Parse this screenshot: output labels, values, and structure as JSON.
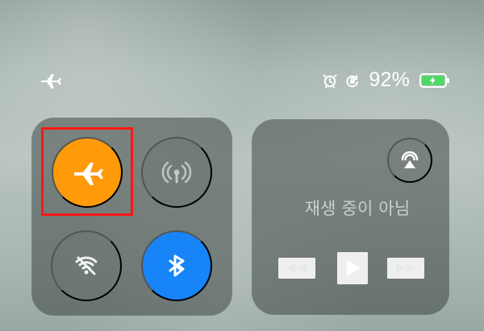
{
  "status_bar": {
    "battery_percent": "92%",
    "left_icon": "airplane-icon",
    "right_icons": [
      "alarm-icon",
      "rotation-lock-icon",
      "battery-icon"
    ]
  },
  "connectivity": {
    "airplane_icon": "airplane-icon",
    "cellular_icon": "cellular-data-icon",
    "wifi_icon": "wifi-off-icon",
    "bluetooth_icon": "bluetooth-icon",
    "airplane_color": "#ff9a0a",
    "bluetooth_color": "#1784f7"
  },
  "media": {
    "now_playing_text": "재생 중이 아님",
    "airplay_icon": "airplay-icon",
    "controls": [
      "previous-track-icon",
      "play-icon",
      "next-track-icon"
    ]
  },
  "annotation": {
    "highlight_color": "#ff1616"
  }
}
